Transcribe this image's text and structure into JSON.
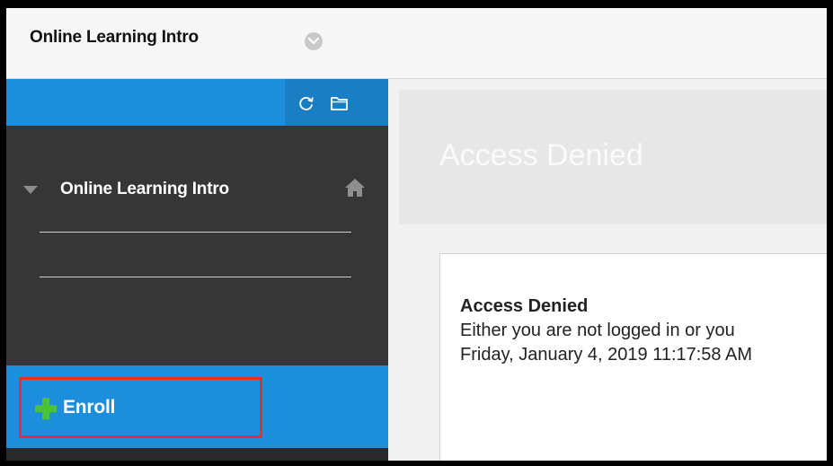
{
  "header": {
    "course_title": "Online Learning Intro",
    "course_menu_icon": "chevron-down-icon"
  },
  "sidebar": {
    "tools": [
      {
        "icon": "refresh-icon"
      },
      {
        "icon": "folder-icon"
      }
    ],
    "course_menu_title": "Online Learning Intro",
    "enroll": {
      "label": "Enroll",
      "icon": "plus-icon"
    }
  },
  "main": {
    "page_title": "Access Denied",
    "message": {
      "title": "Access Denied",
      "line1": "Either you are not logged in or you",
      "line2": "Friday, January 4, 2019 11:17:58 AM"
    }
  },
  "colors": {
    "sidebar_blue": "#1d8edb",
    "sidebar_dark": "#363636",
    "highlight_red": "#e2331f",
    "plus_green": "#4cc13a"
  }
}
